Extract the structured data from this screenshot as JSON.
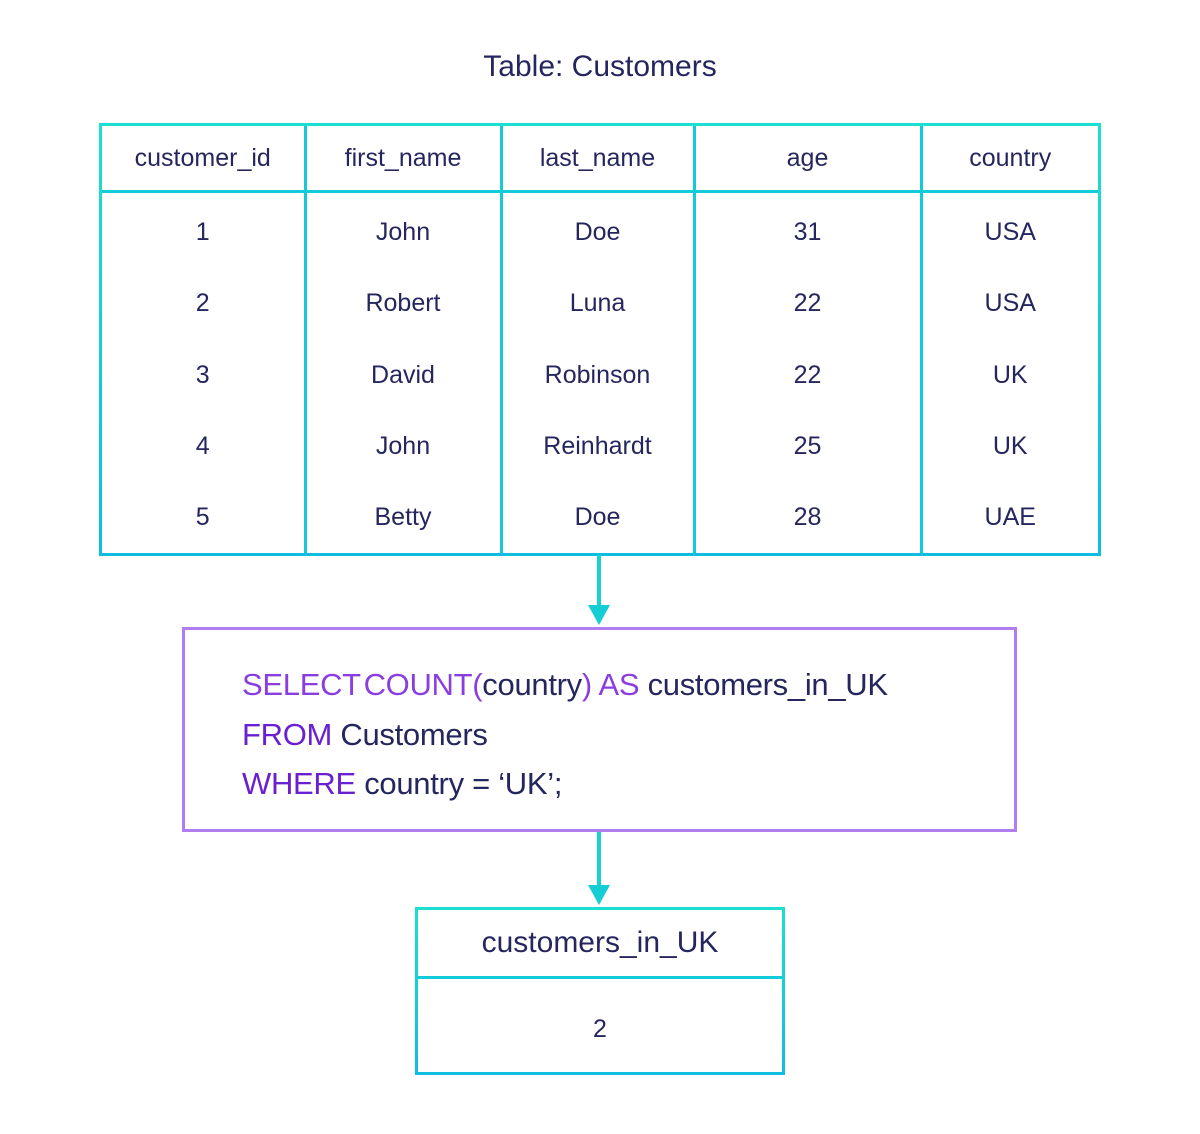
{
  "title": "Table: Customers",
  "customers_table": {
    "columns": [
      "customer_id",
      "first_name",
      "last_name",
      "age",
      "country"
    ],
    "rows": [
      [
        "1",
        "John",
        "Doe",
        "31",
        "USA"
      ],
      [
        "2",
        "Robert",
        "Luna",
        "22",
        "USA"
      ],
      [
        "3",
        "David",
        "Robinson",
        "22",
        "UK"
      ],
      [
        "4",
        "John",
        "Reinhardt",
        "25",
        "UK"
      ],
      [
        "5",
        "Betty",
        "Doe",
        "28",
        "UAE"
      ]
    ]
  },
  "query": {
    "line1": {
      "select": "SELECT",
      "count": "COUNT(",
      "arg": "country",
      "close": ")",
      "as": "AS",
      "alias": "customers_in_UK"
    },
    "line2": {
      "from": "FROM",
      "table": "Customers"
    },
    "line3": {
      "where": "WHERE",
      "condition": "country = ‘UK’;"
    }
  },
  "result_table": {
    "column": "customers_in_UK",
    "value": "2"
  },
  "colors": {
    "table_border": "#1ddfcf",
    "query_border": "#b07ef0",
    "keyword": "#8b3ee0",
    "text": "#25265e"
  }
}
